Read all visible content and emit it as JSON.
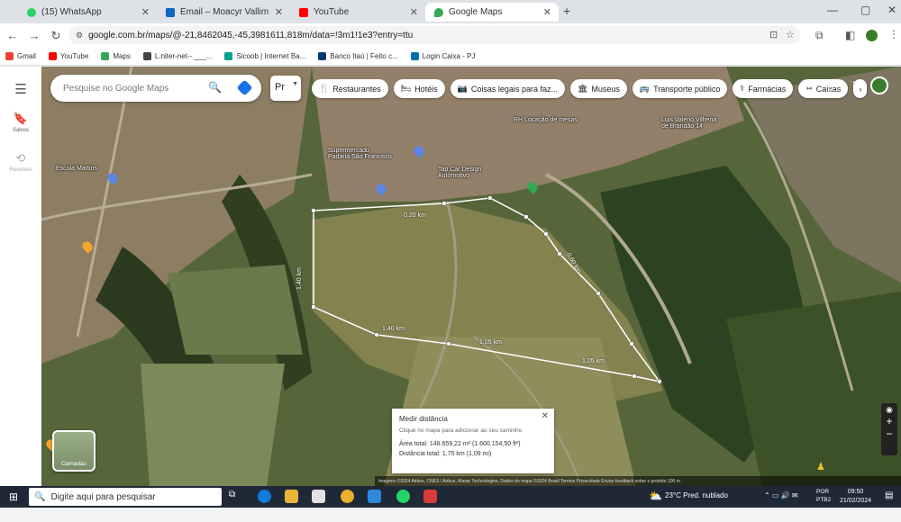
{
  "browser": {
    "tabs": [
      {
        "title": "(15) WhatsApp",
        "color": "#25d366"
      },
      {
        "title": "Email – Moacyr Vallim Filho – O",
        "color": "#0a66c2"
      },
      {
        "title": "YouTube",
        "color": "#ff0000"
      },
      {
        "title": "Google Maps",
        "color": "#34a853"
      }
    ],
    "url": "google.com.br/maps/@-21,8462045,-45,3981611,818m/data=!3m1!1e3?entry=ttu",
    "bookmarks": [
      {
        "label": "Gmail",
        "color": "#ea4335"
      },
      {
        "label": "YouTube",
        "color": "#ff0000"
      },
      {
        "label": "Maps",
        "color": "#34a853"
      },
      {
        "label": "L.niter-net-- ___...",
        "color": "#444444"
      },
      {
        "label": "Sicoob | Internet Ba...",
        "color": "#00a091"
      },
      {
        "label": "Banco Itaú | Feito c...",
        "color": "#003a70"
      },
      {
        "label": "Login Caixa - PJ",
        "color": "#0070af"
      }
    ]
  },
  "rail": {
    "saved": "Salvos",
    "recent": "Recentes"
  },
  "maps": {
    "search_placeholder": "Pesquise no Google Maps",
    "lang_button": "Pr",
    "chips": [
      {
        "icon": "🍴",
        "label": "Restaurantes"
      },
      {
        "icon": "🛏",
        "label": "Hotéis"
      },
      {
        "icon": "📷",
        "label": "Coisas legais para faz..."
      },
      {
        "icon": "🏛",
        "label": "Museus"
      },
      {
        "icon": "🚌",
        "label": "Transporte público"
      },
      {
        "icon": "⚕",
        "label": "Farmácias"
      },
      {
        "icon": "⇿",
        "label": "Caixas"
      }
    ],
    "places": {
      "padaria": "Supermercado\nPadaria São Francisco",
      "locacao": "RH Locação de mesas",
      "luis": "Luis Valério Vilhena\nde Brandão 14",
      "cap": "Tap Car Design\nAutomotivo",
      "escola": "Escola Martins"
    },
    "distances": [
      "0,20 km",
      "0,60 km",
      "1,05 km",
      "1,40 km",
      "1,05 km",
      "1,40 km"
    ],
    "measure": {
      "title": "Medir distância",
      "hint": "Clique no mapa para adicionar ao seu caminho",
      "area": "Área total: 148.659,22 m² (1.600.154,50 ft²)",
      "distance": "Distância total: 1,75 km (1,09 mi)"
    },
    "layers_label": "Camadas",
    "footer": "Imagens ©2024 Airbus, CNES / Airbus, Maxar Technologies, Dados do mapa ©2024   Brasil   Termos   Privacidade   Enviar feedback sobre o produto   100 m"
  },
  "taskbar": {
    "search": "Digite aqui para pesquisar",
    "weather": "23°C  Pred. nublado",
    "lang": "POR\nPTB2",
    "time": "09:50",
    "date": "21/02/2024"
  }
}
